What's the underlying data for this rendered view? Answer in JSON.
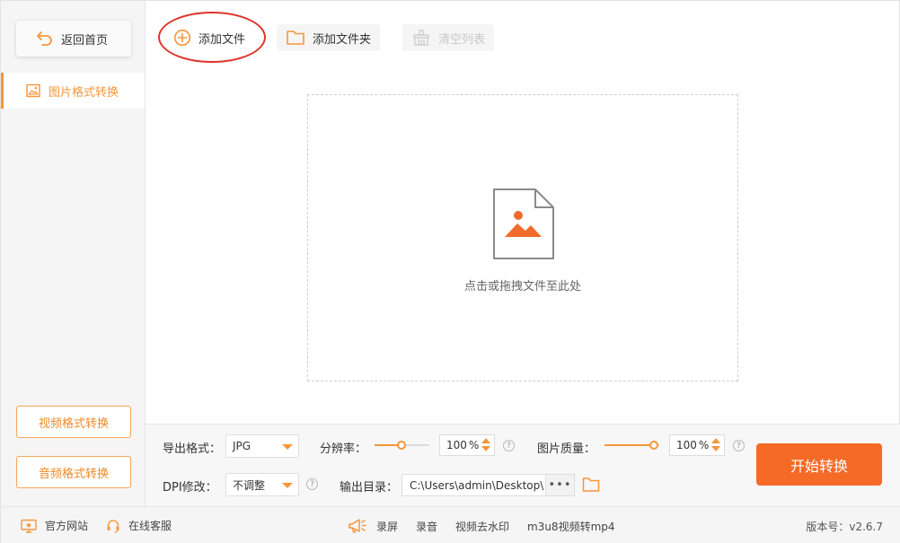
{
  "sidebar": {
    "back_label": "返回首页",
    "active_item": "图片格式转换",
    "video_btn": "视频格式转换",
    "audio_btn": "音频格式转换"
  },
  "toolbar": {
    "add_file": "添加文件",
    "add_folder": "添加文件夹",
    "clear_list": "清空列表"
  },
  "dropzone": {
    "hint": "点击或拖拽文件至此处"
  },
  "settings": {
    "export_format_label": "导出格式：",
    "export_format_value": "JPG",
    "resolution_label": "分辨率：",
    "resolution_value": "100",
    "resolution_unit": "%",
    "quality_label": "图片质量：",
    "quality_value": "100",
    "quality_unit": "%",
    "dpi_label": "DPI修改：",
    "dpi_value": "不调整",
    "output_dir_label": "输出目录：",
    "output_dir_value": "C:\\Users\\admin\\Desktop\\",
    "browse_dots": "•••",
    "start_button": "开始转换",
    "help_glyph": "?"
  },
  "footer": {
    "official_site": "官方网站",
    "online_service": "在线客服",
    "screen_record": "录屏",
    "audio_record": "录音",
    "remove_watermark": "视频去水印",
    "m3u8": "m3u8视频转mp4",
    "version": "版本号：v2.6.7"
  },
  "colors": {
    "accent": "#f6963a",
    "start_button": "#f56a27",
    "annotation": "#e0332b"
  }
}
